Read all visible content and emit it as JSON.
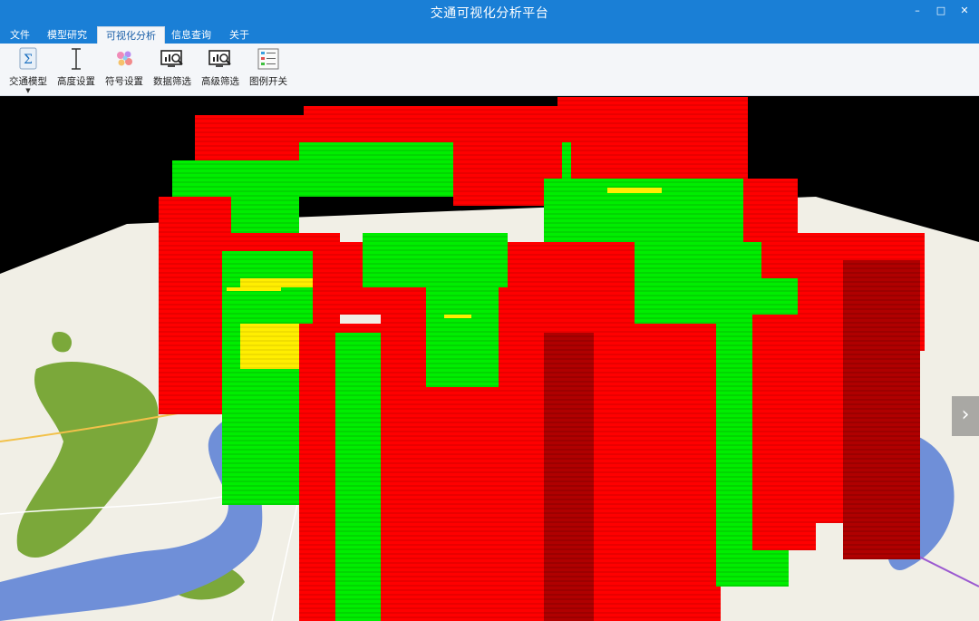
{
  "app": {
    "title": "交通可视化分析平台"
  },
  "window_controls": {
    "minimize": "–",
    "maximize": "□",
    "close": "✕"
  },
  "tabs": [
    {
      "label": "文件"
    },
    {
      "label": "模型研究"
    },
    {
      "label": "可视化分析",
      "active": true
    },
    {
      "label": "信息查询"
    },
    {
      "label": "关于"
    }
  ],
  "ribbon": {
    "buttons": [
      {
        "label": "交通模型",
        "icon": "sigma-model-icon",
        "has_dropdown": true
      },
      {
        "label": "高度设置",
        "icon": "height-icon"
      },
      {
        "label": "符号设置",
        "icon": "symbol-icon"
      },
      {
        "label": "数据筛选",
        "icon": "data-filter-icon"
      },
      {
        "label": "高级筛选",
        "icon": "advanced-filter-icon"
      },
      {
        "label": "图例开关",
        "icon": "legend-icon"
      }
    ]
  },
  "viewport": {
    "next_arrow": "›",
    "colors": {
      "congested": "#ff0000",
      "dark_red": "#b00000",
      "free_flow": "#00ee00",
      "slow": "#ffee00",
      "water": "#6f8fd8",
      "land": "#f1efe6",
      "park": "#7ba83a"
    }
  }
}
